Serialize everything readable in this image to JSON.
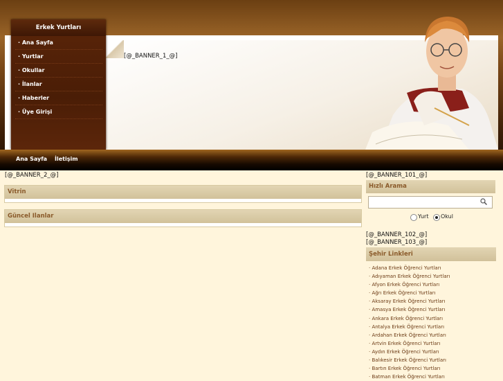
{
  "side_menu": {
    "title": "Erkek Yurtları",
    "items": [
      {
        "label": "· Ana Sayfa"
      },
      {
        "label": "· Yurtlar"
      },
      {
        "label": "· Okullar"
      },
      {
        "label": "· İlanlar"
      },
      {
        "label": "· Haberler"
      },
      {
        "label": "· Üye Girişi"
      }
    ]
  },
  "banners": {
    "b1": "[@_BANNER_1_@]",
    "b2": "[@_BANNER_2_@]",
    "b101": "[@_BANNER_101_@]",
    "b102": "[@_BANNER_102_@]",
    "b103": "[@_BANNER_103_@]"
  },
  "nav": {
    "home": "Ana Sayfa",
    "contact": "İletişim"
  },
  "main": {
    "showcase_title": "Vitrin",
    "current_ads_title": "Güncel Ilanlar"
  },
  "quick_search": {
    "title": "Hızlı Arama",
    "input_value": "",
    "options": [
      {
        "label": "Yurt",
        "selected": false
      },
      {
        "label": "Okul",
        "selected": true
      }
    ]
  },
  "city_links": {
    "title": "Şehir Linkleri",
    "items": [
      "Adana Erkek Öğrenci Yurtları",
      "Adıyaman Erkek Öğrenci Yurtları",
      "Afyon Erkek Öğrenci Yurtları",
      "Ağrı Erkek Öğrenci Yurtları",
      "Aksaray Erkek Öğrenci Yurtları",
      "Amasya Erkek Öğrenci Yurtları",
      "Ankara Erkek Öğrenci Yurtları",
      "Antalya Erkek Öğrenci Yurtları",
      "Ardahan Erkek Öğrenci Yurtları",
      "Artvin Erkek Öğrenci Yurtları",
      "Aydın Erkek Öğrenci Yurtları",
      "Balıkesir Erkek Öğrenci Yurtları",
      "Bartın Erkek Öğrenci Yurtları",
      "Batman Erkek Öğrenci Yurtları"
    ]
  },
  "colors": {
    "page_bg": "#fff5dc",
    "menu_bg": "#4a1d06",
    "box_header": "#d8caa2",
    "link_color": "#6b3a14"
  }
}
